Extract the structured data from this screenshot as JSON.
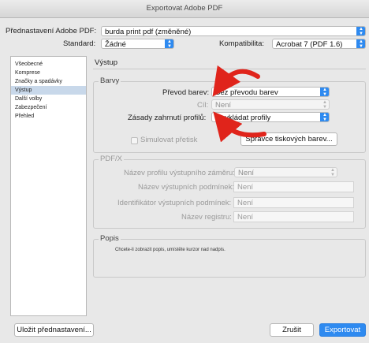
{
  "window": {
    "title": "Exportovat Adobe PDF"
  },
  "top": {
    "preset_label": "Přednastavení Adobe PDF:",
    "preset_value": "burda print pdf (změněné)",
    "standard_label": "Standard:",
    "standard_value": "Žádné",
    "compat_label": "Kompatibilita:",
    "compat_value": "Acrobat 7 (PDF 1.6)"
  },
  "sidebar": {
    "items": [
      {
        "label": "Všeobecné"
      },
      {
        "label": "Komprese"
      },
      {
        "label": "Značky a spadávky"
      },
      {
        "label": "Výstup",
        "selected": true
      },
      {
        "label": "Další volby"
      },
      {
        "label": "Zabezpečení"
      },
      {
        "label": "Přehled"
      }
    ]
  },
  "panel": {
    "title": "Výstup",
    "barvy": {
      "title": "Barvy",
      "conversion_label": "Převod barev:",
      "conversion_value": "Bez převodu barev",
      "target_label": "Cíl:",
      "target_value": "Není",
      "profile_label": "Zásady zahrnutí profilů:",
      "profile_value": "Nevkládat profily",
      "simulate_label": "Simulovat přetisk",
      "ink_manager_label": "Správce tiskových barev..."
    },
    "pdfx": {
      "title": "PDF/X",
      "output_intent_label": "Název profilu výstupního záměru:",
      "output_intent_value": "Není",
      "output_cond_name_label": "Název výstupních podmínek:",
      "output_cond_name_value": "Není",
      "output_cond_id_label": "Identifikátor výstupních podmínek:",
      "output_cond_id_value": "Není",
      "registry_label": "Název registru:",
      "registry_value": "Není"
    },
    "popis": {
      "title": "Popis",
      "text": "Chcete-li zobrazit popis, umístěte kurzor nad nadpis."
    }
  },
  "footer": {
    "save_preset_label": "Uložit přednastavení...",
    "cancel_label": "Zrušit",
    "export_label": "Exportovat"
  },
  "colors": {
    "accent": "#2e8af0",
    "annotation_arrow": "#e0241b",
    "selection": "#c8d8ea"
  }
}
